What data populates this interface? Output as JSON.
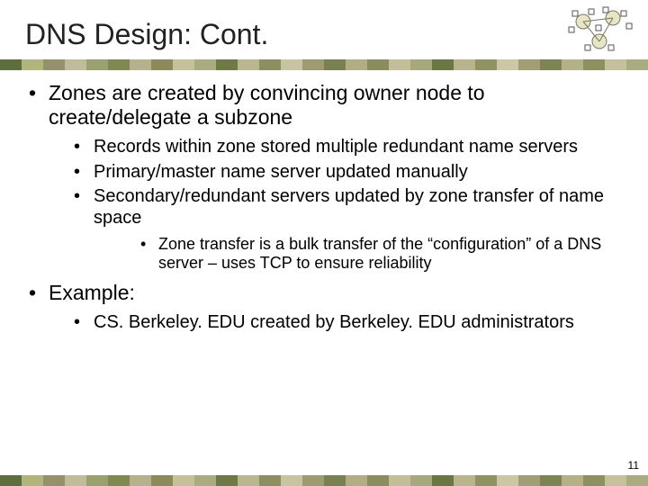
{
  "title": "DNS Design: Cont.",
  "bullets": {
    "b1": "Zones are created by convincing owner node to create/delegate a subzone",
    "b1_1": "Records within zone stored multiple redundant name servers",
    "b1_2": "Primary/master name server updated manually",
    "b1_3": "Secondary/redundant servers updated by zone transfer of name space",
    "b1_3_1": "Zone transfer is a bulk transfer of the “configuration” of a DNS server – uses TCP to ensure reliability",
    "b2": "Example:",
    "b2_1": "CS. Berkeley. EDU created by Berkeley. EDU administrators"
  },
  "page_number": "11",
  "band_colors": [
    "#5d6f3f",
    "#b0b57b",
    "#96916a",
    "#c0bb9a",
    "#9aa06f",
    "#7f8a50",
    "#b7b08c",
    "#8d8a5a",
    "#c5c09a",
    "#a9ac80",
    "#6d7a45",
    "#bab68f",
    "#8c9060",
    "#c8c3a0",
    "#9e9a72",
    "#7a8150",
    "#b3ad86",
    "#8a8e5e",
    "#c3be99",
    "#a6a97c",
    "#6a7742",
    "#b9b48e",
    "#8f9362",
    "#cbc6a3",
    "#a19d75",
    "#7d8453",
    "#b6b089",
    "#8d915f",
    "#c6c19c",
    "#a9ac80"
  ]
}
